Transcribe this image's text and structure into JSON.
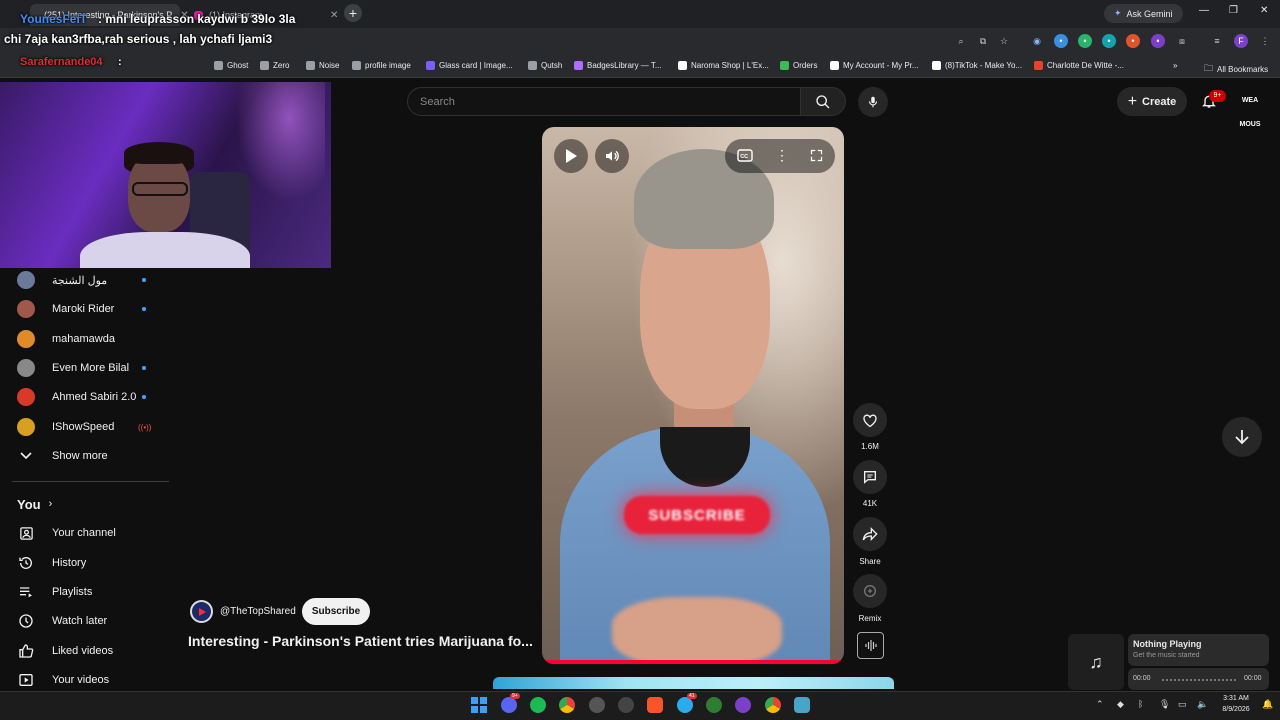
{
  "browser": {
    "tabs": [
      {
        "title": "(251) Interesting - Parkinson's P",
        "close": "✕"
      },
      {
        "title": "(1) Instagram",
        "close": "✕"
      }
    ],
    "new_tab": "+",
    "ask_gemini": "Ask Gemini",
    "window_controls": {
      "minimize": "—",
      "restore": "❐",
      "close": "✕"
    },
    "profile_initial": "F",
    "bookmarks": [
      {
        "label": "Ghost",
        "color": "#9aa0a6"
      },
      {
        "label": "Zero",
        "color": "#9aa0a6"
      },
      {
        "label": "Noise",
        "color": "#9aa0a6"
      },
      {
        "label": "profile image",
        "color": "#9aa0a6"
      },
      {
        "label": "Glass card | Image...",
        "color": "#7c5cff"
      },
      {
        "label": "Qutsh",
        "color": "#9aa0a6"
      },
      {
        "label": "BadgesLibrary — T...",
        "color": "#b06cff"
      },
      {
        "label": "Naroma Shop | L'Ex...",
        "color": "#ffffff"
      },
      {
        "label": "Orders",
        "color": "#3cba54"
      },
      {
        "label": "My Account - My Pr...",
        "color": "#ffffff"
      },
      {
        "label": "(8)TikTok - Make Yo...",
        "color": "#ffffff"
      },
      {
        "label": "Charlotte De Witte -...",
        "color": "#e6442a"
      }
    ],
    "bookmarks_more": "»",
    "all_bookmarks": "All Bookmarks"
  },
  "overlay": {
    "username": "YounesFeiT",
    "line1": ": mni leuprasson kaydwi b 39lo 3la",
    "line2": "chi 7aja kan3rfba,rah serious , lah ychafi ljami3",
    "username2": "Sarafernande04",
    "colon2": ":"
  },
  "youtube": {
    "search_placeholder": "Search",
    "create_label": "Create",
    "notifications_badge": "9+",
    "avatar_text": "WEA MOUS"
  },
  "sidebar": {
    "subscriptions": [
      {
        "name": "مول الشنجة",
        "color": "#6b7a99",
        "indicator": "dot"
      },
      {
        "name": "Maroki Rider",
        "color": "#a0584a",
        "indicator": "dot"
      },
      {
        "name": "mahamawda",
        "color": "#e08a2a",
        "indicator": "none"
      },
      {
        "name": "Even More Bilal",
        "color": "#888888",
        "indicator": "dot"
      },
      {
        "name": "Ahmed Sabiri 2.0",
        "color": "#d83a2a",
        "indicator": "dot"
      },
      {
        "name": "IShowSpeed",
        "color": "#d8a020",
        "indicator": "live"
      }
    ],
    "live_icon": "((•))",
    "show_more": "Show more",
    "you_header": "You",
    "you_items": [
      {
        "label": "Your channel",
        "icon": "person-box-icon"
      },
      {
        "label": "History",
        "icon": "history-icon"
      },
      {
        "label": "Playlists",
        "icon": "playlist-icon"
      },
      {
        "label": "Watch later",
        "icon": "clock-icon"
      },
      {
        "label": "Liked videos",
        "icon": "thumbs-up-icon"
      },
      {
        "label": "Your videos",
        "icon": "play-box-icon"
      }
    ]
  },
  "video": {
    "overlay_text": "SUBSCRIBE",
    "progress": 1.0,
    "channel": "@TheTopShared",
    "subscribe_label": "Subscribe",
    "title": "Interesting - Parkinson's Patient tries Marijuana fo...",
    "actions": {
      "likes": "1.6M",
      "comments": "41K",
      "share": "Share",
      "remix": "Remix"
    }
  },
  "music_widget": {
    "title": "Nothing Playing",
    "subtitle": "Get the music started",
    "time_start": "00:00",
    "time_end": "00:00"
  },
  "taskbar": {
    "time": "3:31 AM",
    "date": "8/9/2026",
    "badge_discord": "9+",
    "badge_telegram": "41"
  }
}
